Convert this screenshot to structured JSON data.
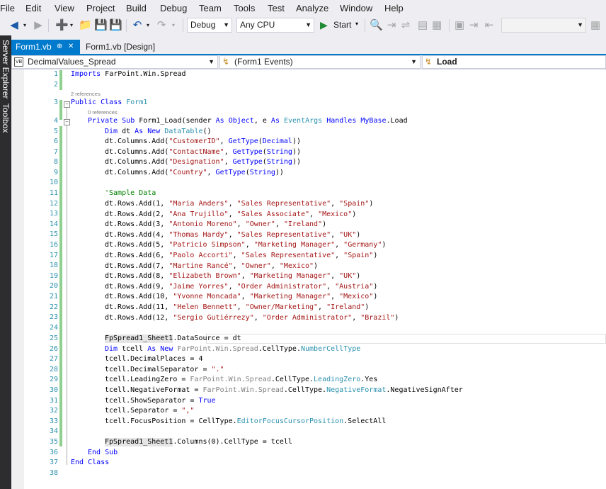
{
  "menu": [
    "File",
    "Edit",
    "View",
    "Project",
    "Build",
    "Debug",
    "Team",
    "Tools",
    "Test",
    "Analyze",
    "Window",
    "Help"
  ],
  "toolbar": {
    "config": "Debug",
    "platform": "Any CPU",
    "start": "Start"
  },
  "side_tabs": [
    "Server Explorer",
    "Toolbox"
  ],
  "tabs": {
    "active": "Form1.vb",
    "pin": "⊕",
    "close": "✕",
    "design": "Form1.vb [Design]"
  },
  "nav": {
    "project": "DecimalValues_Spread",
    "events": "(Form1 Events)",
    "member": "Load"
  },
  "code": {
    "line_numbers": [
      "1",
      "2",
      "3",
      "4",
      "5",
      "6",
      "7",
      "8",
      "9",
      "10",
      "11",
      "12",
      "13",
      "14",
      "15",
      "16",
      "17",
      "18",
      "19",
      "20",
      "21",
      "22",
      "23",
      "24",
      "25",
      "26",
      "27",
      "28",
      "29",
      "30",
      "31",
      "32",
      "33",
      "34",
      "35",
      "36",
      "37",
      "38"
    ],
    "refs_2": "2 references",
    "refs_0": "0 references",
    "l1_kw": "Imports",
    "l1_rest": " FarPoint.Win.Spread",
    "l3_kw": "Public Class",
    "l3_name": " Form1",
    "l4_kw1": "Private Sub",
    "l4_a": " Form1_Load(sender ",
    "l4_as1": "As",
    "l4_obj": " Object",
    "l4_b": ", e ",
    "l4_as2": "As",
    "l4_evt": " EventArgs",
    "l4_handles": " Handles",
    "l4_mybase": " MyBase",
    "l4_c": ".Load",
    "l5_dim": "Dim",
    "l5_a": " dt ",
    "l5_asnew": "As New",
    "l5_ty": " DataTable",
    "l5_b": "()",
    "cols": [
      {
        "pre": "dt.Columns.Add(",
        "name": "\"CustomerID\"",
        "mid": ", ",
        "gt": "GetType",
        "lp": "(",
        "ty": "Decimal",
        "end": "))"
      },
      {
        "pre": "dt.Columns.Add(",
        "name": "\"ContactName\"",
        "mid": ", ",
        "gt": "GetType",
        "lp": "(",
        "ty": "String",
        "end": "))"
      },
      {
        "pre": "dt.Columns.Add(",
        "name": "\"Designation\"",
        "mid": ", ",
        "gt": "GetType",
        "lp": "(",
        "ty": "String",
        "end": "))"
      },
      {
        "pre": "dt.Columns.Add(",
        "name": "\"Country\"",
        "mid": ", ",
        "gt": "GetType",
        "lp": "(",
        "ty": "String",
        "end": "))"
      }
    ],
    "comment": "'Sample Data",
    "rows": [
      {
        "pre": "dt.Rows.Add(1, ",
        "a": "\"Maria Anders\"",
        "b": "\"Sales Representative\"",
        "c": "\"Spain\""
      },
      {
        "pre": "dt.Rows.Add(2, ",
        "a": "\"Ana Trujillo\"",
        "b": "\"Sales Associate\"",
        "c": "\"Mexico\""
      },
      {
        "pre": "dt.Rows.Add(3, ",
        "a": "\"Antonio Moreno\"",
        "b": "\"Owner\"",
        "c": "\"Ireland\""
      },
      {
        "pre": "dt.Rows.Add(4, ",
        "a": "\"Thomas Hardy\"",
        "b": "\"Sales Representative\"",
        "c": "\"UK\""
      },
      {
        "pre": "dt.Rows.Add(5, ",
        "a": "\"Patricio Simpson\"",
        "b": "\"Marketing Manager\"",
        "c": "\"Germany\""
      },
      {
        "pre": "dt.Rows.Add(6, ",
        "a": "\"Paolo Accorti\"",
        "b": "\"Sales Representative\"",
        "c": "\"Spain\""
      },
      {
        "pre": "dt.Rows.Add(7, ",
        "a": "\"Martine Rancé\"",
        "b": "\"Owner\"",
        "c": "\"Mexico\""
      },
      {
        "pre": "dt.Rows.Add(8, ",
        "a": "\"Elizabeth Brown\"",
        "b": "\"Marketing Manager\"",
        "c": "\"UK\""
      },
      {
        "pre": "dt.Rows.Add(9, ",
        "a": "\"Jaime Yorres\"",
        "b": "\"Order Administrator\"",
        "c": "\"Austria\""
      },
      {
        "pre": "dt.Rows.Add(10, ",
        "a": "\"Yvonne Moncada\"",
        "b": "\"Marketing Manager\"",
        "c": "\"Mexico\""
      },
      {
        "pre": "dt.Rows.Add(11, ",
        "a": "\"Helen Bennett\"",
        "b": "\"Owner/Marketing\"",
        "c": "\"Ireland\""
      },
      {
        "pre": "dt.Rows.Add(12, ",
        "a": "\"Sergio Gutiérrezy\"",
        "b": "\"Order Administrator\"",
        "c": "\"Brazil\""
      }
    ],
    "sep": ", ",
    "close": ")",
    "l25": "FpSpread1_Sheet1.DataSource = dt",
    "l26_dim": "Dim",
    "l26_a": " tcell ",
    "l26_asnew": "As New",
    "l26_ns": " FarPoint.Win.Spread",
    "l26_ct": ".CellType.",
    "l26_ty": "NumberCellType",
    "l27": "tcell.DecimalPlaces = 4",
    "l28_a": "tcell.DecimalSeparator = ",
    "l28_s": "\".\"",
    "l29_a": "tcell.LeadingZero = ",
    "l29_ns": "FarPoint.Win.Spread",
    "l29_ct": ".CellType.",
    "l29_ty": "LeadingZero",
    "l29_e": ".Yes",
    "l30_a": "tcell.NegativeFormat = ",
    "l30_ns": "FarPoint.Win.Spread",
    "l30_ct": ".CellType.",
    "l30_ty": "NegativeFormat",
    "l30_e": ".NegativeSignAfter",
    "l31_a": "tcell.ShowSeparator = ",
    "l31_kw": "True",
    "l32_a": "tcell.Separator = ",
    "l32_s": "\",\"",
    "l33_a": "tcell.FocusPosition = CellType.",
    "l33_ty": "EditorFocusCursorPosition",
    "l33_e": ".SelectAll",
    "l35": "FpSpread1_Sheet1.Columns(0).CellType = tcell",
    "l36": "End Sub",
    "l37": "End Class"
  }
}
